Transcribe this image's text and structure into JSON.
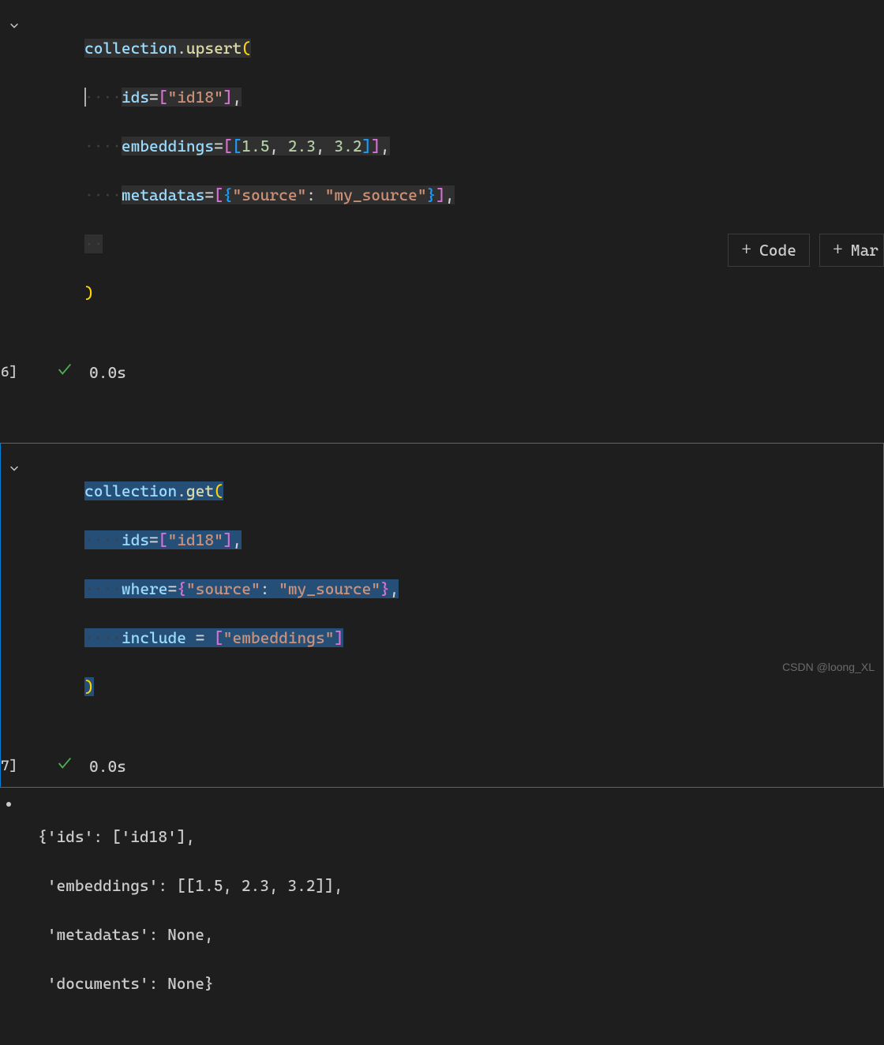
{
  "cell1": {
    "exec_label": "6]",
    "exec_time": "0.0s",
    "code": {
      "line1": {
        "obj": "collection",
        "dot": ".",
        "method": "upsert",
        "open": "("
      },
      "line2": {
        "kw": "ids",
        "eq": "=",
        "lb": "[",
        "str": "\"id18\"",
        "rb": "]",
        "comma": ","
      },
      "line3": {
        "kw": "embeddings",
        "eq": "=",
        "lb1": "[",
        "lb2": "[",
        "n1": "1.5",
        "c1": ", ",
        "n2": "2.3",
        "c2": ", ",
        "n3": "3.2",
        "rb2": "]",
        "rb1": "]",
        "comma": ","
      },
      "line4": {
        "kw": "metadatas",
        "eq": "=",
        "lb": "[",
        "lbr": "{",
        "k": "\"source\"",
        "colon": ": ",
        "v": "\"my_source\"",
        "rbr": "}",
        "rb": "]",
        "comma": ","
      },
      "line5": {
        "ws": "  "
      },
      "line6": {
        "close": ")"
      }
    }
  },
  "insert": {
    "code": "Code",
    "md": "Mar"
  },
  "cell2": {
    "exec_label": "7]",
    "exec_time": "0.0s",
    "code": {
      "line1": {
        "obj": "collection",
        "dot": ".",
        "method": "get",
        "open": "("
      },
      "line2": {
        "kw": "ids",
        "eq": "=",
        "lb": "[",
        "str": "\"id18\"",
        "rb": "]",
        "comma": ","
      },
      "line3": {
        "kw": "where",
        "eq": "=",
        "lbr": "{",
        "k": "\"source\"",
        "colon": ": ",
        "v": "\"my_source\"",
        "rbr": "}",
        "comma": ","
      },
      "line4": {
        "kw": "include",
        "sp": " ",
        "eq": "=",
        "sp2": " ",
        "lb": "[",
        "str": "\"embeddings\"",
        "rb": "]"
      },
      "line5": {
        "close": ")"
      }
    }
  },
  "output": {
    "l1": "{'ids': ['id18'],",
    "l2": " 'embeddings': [[1.5, 2.3, 3.2]],",
    "l3": " 'metadatas': None,",
    "l4": " 'documents': None}"
  },
  "watermark": "CSDN @loong_XL",
  "chart_data": null
}
